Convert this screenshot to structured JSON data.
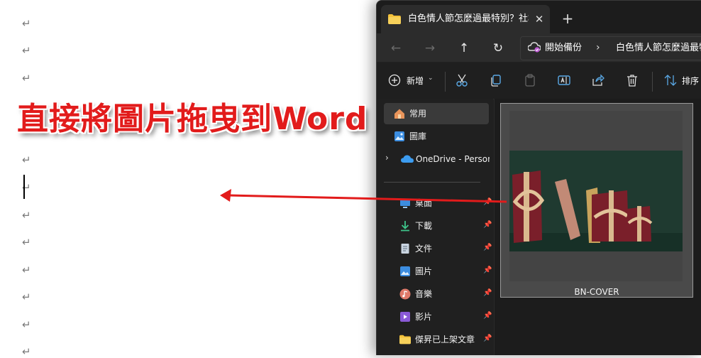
{
  "caption": "直接將圖片拖曳到Word",
  "document": {
    "paragraph_mark": "↵"
  },
  "explorer": {
    "tab": {
      "title": "白色情人節怎麼過最特別？社群",
      "close": "✕",
      "new": "+"
    },
    "nav": {
      "back": "←",
      "forward": "→",
      "up": "↑",
      "refresh": "↻",
      "breadcrumb_1": "開始備份",
      "separator": "›",
      "breadcrumb_2": "白色情人節怎麼過最特別"
    },
    "toolbar": {
      "new_label": "新增",
      "new_caret": "⌄",
      "sort_label": "排序"
    },
    "sidebar": {
      "expand": "›",
      "items": [
        {
          "label": "常用",
          "icon": "home-icon"
        },
        {
          "label": "圖庫",
          "icon": "gallery-icon"
        },
        {
          "label": "OneDrive - Personal",
          "icon": "onedrive-icon"
        },
        {
          "label": "桌面",
          "icon": "desktop-icon"
        },
        {
          "label": "下載",
          "icon": "download-icon"
        },
        {
          "label": "文件",
          "icon": "documents-icon"
        },
        {
          "label": "圖片",
          "icon": "pictures-icon"
        },
        {
          "label": "音樂",
          "icon": "music-icon"
        },
        {
          "label": "影片",
          "icon": "videos-icon"
        },
        {
          "label": "傑昇已上架文章",
          "icon": "folder-icon"
        }
      ],
      "pin": "📌"
    },
    "files": [
      {
        "name": "BN-COVER"
      }
    ]
  },
  "colors": {
    "caption": "#e21b1b",
    "arrow": "#e21b1b",
    "explorer_bg": "#202020",
    "folder": "#f3c13a"
  }
}
